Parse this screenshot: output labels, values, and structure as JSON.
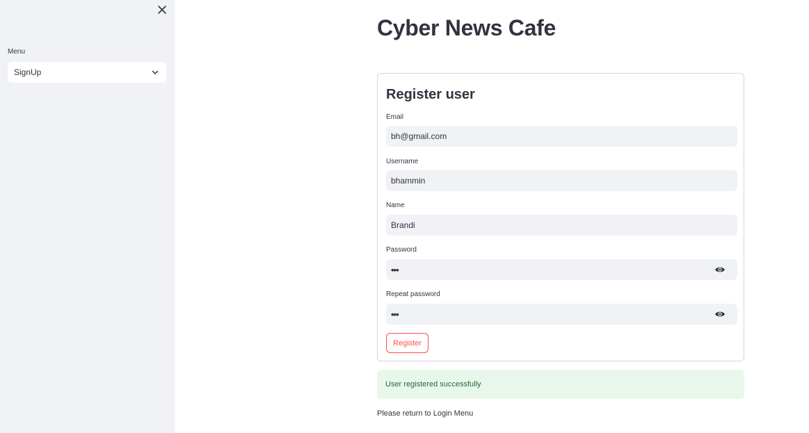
{
  "sidebar": {
    "close_icon": "close-icon",
    "menu_label": "Menu",
    "menu_value": "SignUp",
    "menu_chevron_icon": "chevron-down-icon"
  },
  "main": {
    "title": "Cyber News Cafe",
    "form": {
      "title": "Register user",
      "fields": [
        {
          "label": "Email",
          "value": "bh@gmail.com"
        },
        {
          "label": "Username",
          "value": "bhammin"
        },
        {
          "label": "Name",
          "value": "Brandi"
        },
        {
          "label": "Password",
          "value": "•••",
          "icon": "eye-icon"
        },
        {
          "label": "Repeat password",
          "value": "•••",
          "icon": "eye-icon"
        }
      ],
      "submit_label": "Register"
    },
    "success_message": "User registered successfully",
    "return_note": "Please return to Login Menu"
  },
  "colors": {
    "sidebar_bg": "#f0f2f6",
    "field_bg": "#f0f2f6",
    "primary_red": "#ff4b4b",
    "success_bg": "#e8f7ec",
    "success_text": "#1d6b3a",
    "text": "#31333f"
  }
}
